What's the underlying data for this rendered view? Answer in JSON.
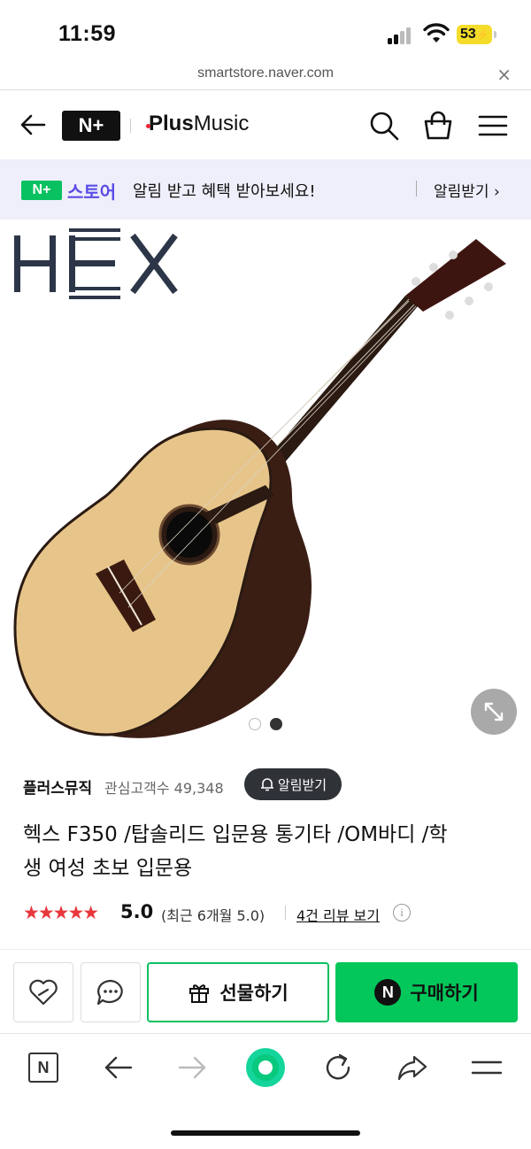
{
  "status_bar": {
    "time": "11:59",
    "battery": "53"
  },
  "browser": {
    "url": "smartstore.naver.com",
    "close_label": "×"
  },
  "header": {
    "naver_plus_logo": "N+",
    "store_name_bold": "Plus",
    "store_name_rest": "Music",
    "icons": [
      "back-arrow-icon",
      "search-icon",
      "shopping-bag-icon",
      "menu-icon"
    ]
  },
  "banner": {
    "logo_badge": "N+",
    "logo_text": "스토어",
    "message": "알림 받고 혜택 받아보세요!",
    "action": "알림받기 ›"
  },
  "product_image": {
    "brand_logo": "HEX",
    "carousel_total": 2,
    "carousel_active_index": 1
  },
  "seller": {
    "name": "플러스뮤직",
    "fans_label": "관심고객수 49,348",
    "alarm_button": "알림받기"
  },
  "product": {
    "title_line1": "헥스 F350 /탑솔리드 입문용 통기타 /OM바디 /학",
    "title_line2": "생 여성 초보 입문용"
  },
  "rating": {
    "stars": "★★★★★",
    "score": "5.0",
    "recent": "(최근 6개월 5.0)",
    "reviews_link": "4건 리뷰 보기",
    "info_glyph": "i"
  },
  "actions": {
    "gift_label": "선물하기",
    "buy_label": "구매하기",
    "buy_badge": "N"
  },
  "toolbar": {
    "naver_button": "N"
  },
  "colors": {
    "naver_green": "#03c75a",
    "store_purple": "#5b4de6",
    "star_red": "#e8383d",
    "banner_bg": "#efeffb"
  }
}
